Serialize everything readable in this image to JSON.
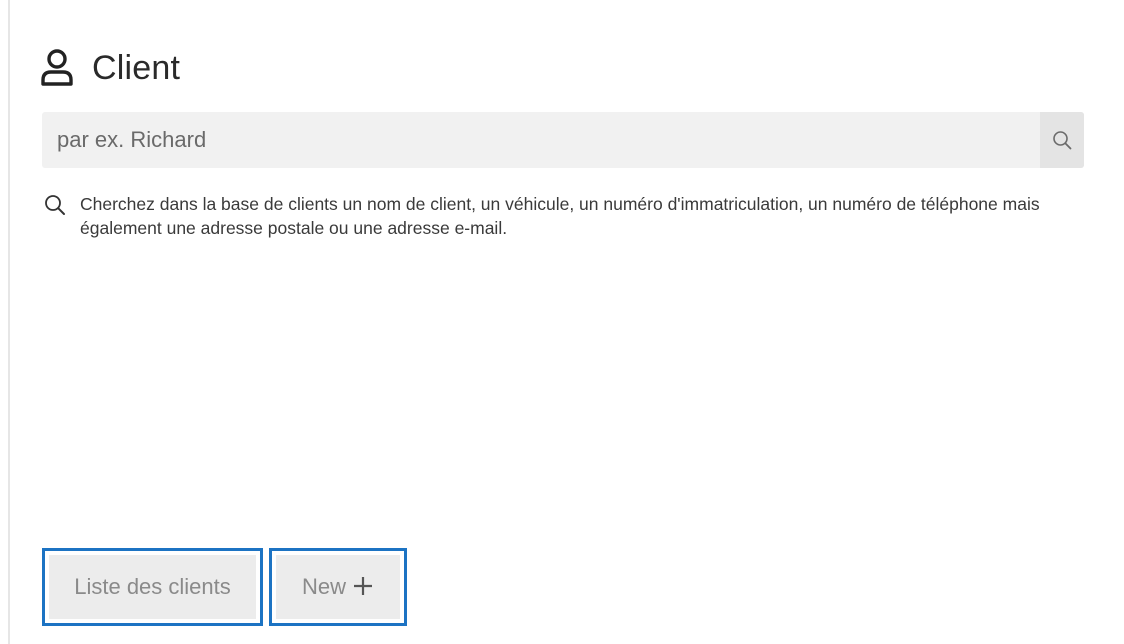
{
  "panel": {
    "title": "Client",
    "title_icon": "user-icon"
  },
  "search": {
    "placeholder": "par ex. Richard",
    "value": "",
    "button_icon": "search-icon"
  },
  "hint": {
    "icon": "search-icon",
    "text": "Cherchez dans la base de clients un nom de client, un véhicule, un numéro d'immatriculation, un numéro de téléphone mais également une adresse postale ou une adresse e-mail."
  },
  "actions": {
    "list_label": "Liste des clients",
    "new_label": "New",
    "new_icon": "plus-icon"
  },
  "colors": {
    "focus_border": "#1c73c3",
    "button_bg": "#ececec",
    "input_bg": "#f1f1f1"
  }
}
